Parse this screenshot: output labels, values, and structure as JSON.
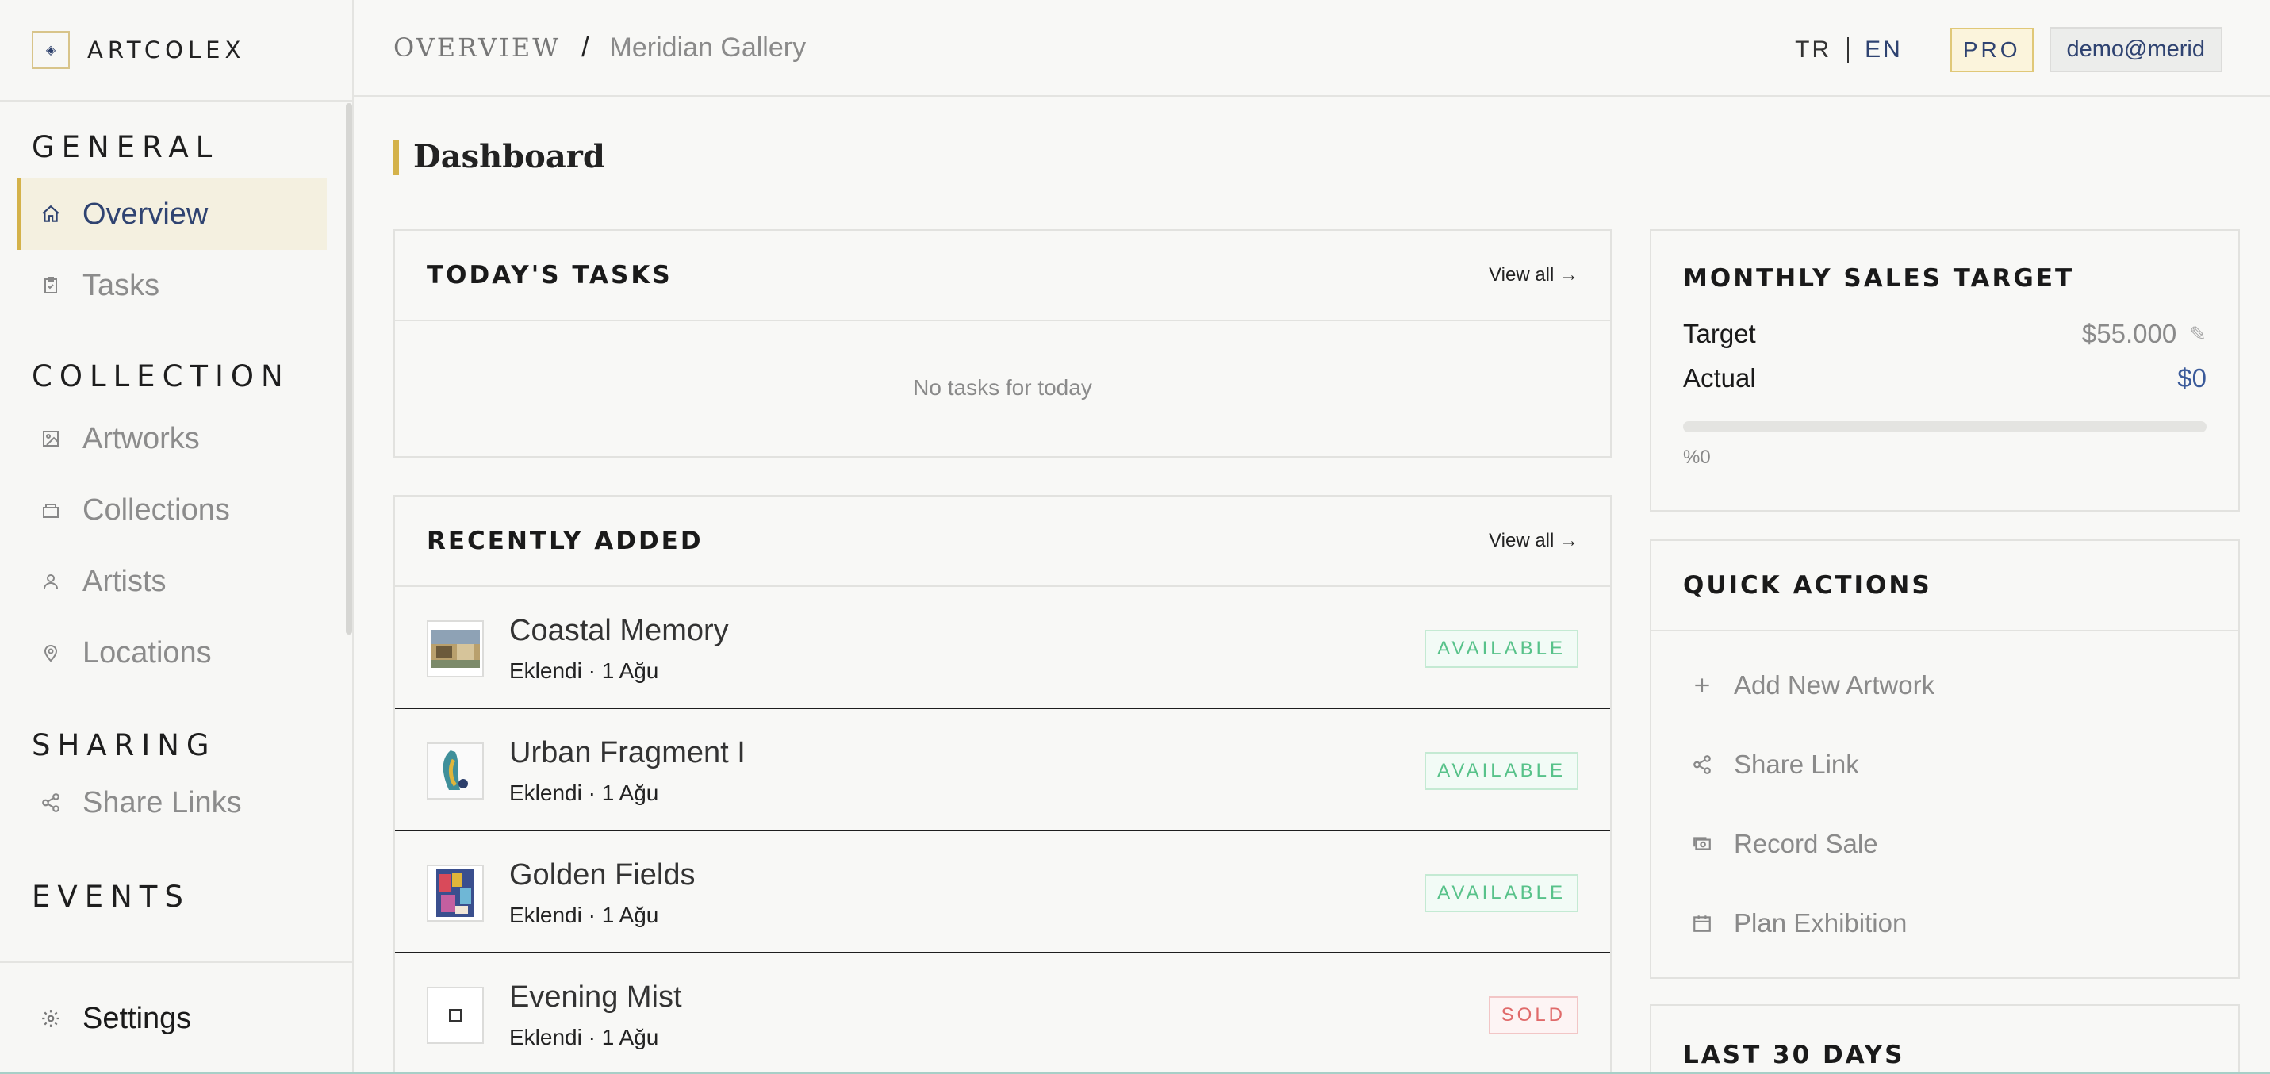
{
  "brand": {
    "name": "ARTCOLEX"
  },
  "sidebar": {
    "sections": [
      {
        "title": "GENERAL",
        "items": [
          {
            "label": "Overview",
            "icon": "home-icon",
            "active": true
          },
          {
            "label": "Tasks",
            "icon": "clipboard-icon"
          }
        ]
      },
      {
        "title": "COLLECTION",
        "items": [
          {
            "label": "Artworks",
            "icon": "image-icon"
          },
          {
            "label": "Collections",
            "icon": "folder-stack-icon"
          },
          {
            "label": "Artists",
            "icon": "person-icon"
          },
          {
            "label": "Locations",
            "icon": "map-pin-icon"
          }
        ]
      },
      {
        "title": "SHARING",
        "items": [
          {
            "label": "Share Links",
            "icon": "share-icon"
          }
        ]
      },
      {
        "title": "EVENTS",
        "items": []
      }
    ],
    "settings_label": "Settings"
  },
  "topbar": {
    "crumb_root": "OVERVIEW",
    "crumb_sep": "/",
    "crumb_page": "Meridian Gallery",
    "lang_tr": "TR",
    "lang_en": "EN",
    "plan_badge": "PRO",
    "user": "demo@merid"
  },
  "page": {
    "title": "Dashboard"
  },
  "tasks": {
    "title": "TODAY'S TASKS",
    "view_all": "View all →",
    "empty": "No tasks for today"
  },
  "recent": {
    "title": "RECENTLY ADDED",
    "view_all": "View all →",
    "items": [
      {
        "title": "Coastal Memory",
        "sub": "Eklendi · 1 Ağu",
        "status": "AVAILABLE"
      },
      {
        "title": "Urban Fragment I",
        "sub": "Eklendi · 1 Ağu",
        "status": "AVAILABLE"
      },
      {
        "title": "Golden Fields",
        "sub": "Eklendi · 1 Ağu",
        "status": "AVAILABLE"
      },
      {
        "title": "Evening Mist",
        "sub": "Eklendi · 1 Ağu",
        "status": "SOLD"
      }
    ]
  },
  "sales_target": {
    "title": "MONTHLY SALES TARGET",
    "target_label": "Target",
    "target_value": "$55.000",
    "actual_label": "Actual",
    "actual_value": "$0",
    "progress_fraction": 0,
    "percent_label": "%0"
  },
  "quick_actions": {
    "title": "QUICK ACTIONS",
    "items": [
      {
        "label": "Add New Artwork",
        "icon": "plus-icon"
      },
      {
        "label": "Share Link",
        "icon": "share-icon"
      },
      {
        "label": "Record Sale",
        "icon": "cash-icon"
      },
      {
        "label": "Plan Exhibition",
        "icon": "calendar-icon"
      }
    ]
  },
  "last30": {
    "title": "LAST 30 DAYS"
  },
  "colors": {
    "accent_gold": "#d4b24a",
    "brand_navy": "#2f4371",
    "available": "#58c28a",
    "sold": "#e06a6a"
  }
}
